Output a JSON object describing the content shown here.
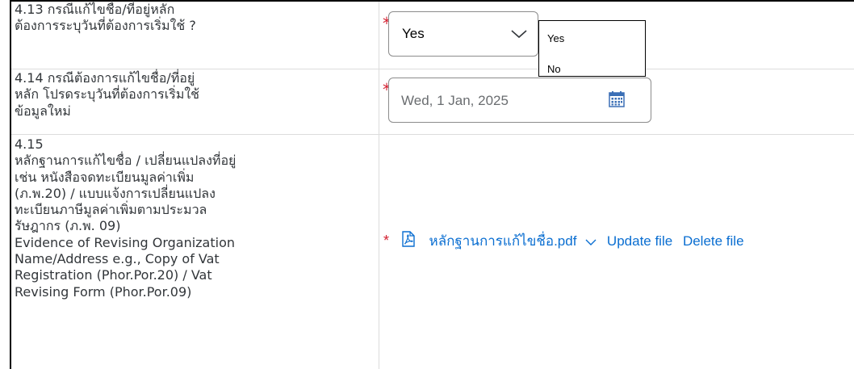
{
  "q413": {
    "lines": [
      "4.13  กรณีแก้ไขชื่อ/ที่อยู่หลัก",
      "ต้องการระบุวันที่ต้องการเริ่มใช้ ?"
    ],
    "required": "*",
    "select_value": "Yes",
    "options": [
      "Yes",
      "No"
    ]
  },
  "q414": {
    "lines": [
      "4.14  กรณีต้องการแก้ไขชื่อ/ที่อยู่",
      "หลัก โปรดระบุวันที่ต้องการเริ่มใช้",
      "ข้อมูลใหม่"
    ],
    "required": "*",
    "date_value": "Wed, 1 Jan, 2025"
  },
  "q415": {
    "lines": [
      "4.15",
      "หลักฐานการแก้ไขชื่อ / เปลี่ยนแปลงที่อยู่",
      "เช่น หนังสือจดทะเบียนมูลค่าเพิ่ม",
      "(ภ.พ.20) / แบบแจ้งการเปลี่ยนแปลง",
      "ทะเบียนภาษีมูลค่าเพิ่มตามประมวล",
      "รัษฎากร (ภ.พ. 09)",
      "Evidence of Revising Organization",
      "Name/Address e.g., Copy of Vat",
      "Registration (Phor.Por.20) / Vat",
      "Revising Form (Phor.Por.09)"
    ],
    "required": "*",
    "file_name": "หลักฐานการแก้ไขชื่อ.pdf",
    "update_label": "Update file",
    "delete_label": "Delete file"
  },
  "colors": {
    "required": "#d32030",
    "link": "#0a6ed1",
    "text": "#32363a",
    "border": "#8c8c8c"
  },
  "icons": [
    "chevron-down-icon",
    "calendar-icon",
    "pdf-file-icon"
  ]
}
